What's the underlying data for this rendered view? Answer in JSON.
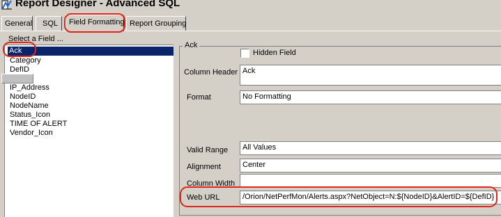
{
  "window": {
    "title": "Report Designer - Advanced SQL"
  },
  "tabs": [
    {
      "label": "General"
    },
    {
      "label": "SQL"
    },
    {
      "label": "Field Formatting"
    },
    {
      "label": "Report Grouping"
    }
  ],
  "field_list": {
    "caption": "Select a Field ...",
    "items": [
      "Ack",
      "Category",
      "DefID",
      "IP_Address",
      "NodeID",
      "NodeName",
      "Status_Icon",
      "TIME OF ALERT",
      "Vendor_Icon"
    ],
    "selected": "Ack"
  },
  "details": {
    "group_title": "Ack",
    "hidden_field": {
      "label": "Hidden Field",
      "checked": false
    },
    "column_header": {
      "label": "Column Header",
      "value": "Ack"
    },
    "format": {
      "label": "Format",
      "value": "No Formatting"
    },
    "valid_range": {
      "label": "Valid Range",
      "value": "All Values"
    },
    "alignment": {
      "label": "Alignment",
      "value": "Center"
    },
    "column_width": {
      "label": "Column Width",
      "value": ""
    },
    "web_url": {
      "label": "Web URL",
      "value": "/Orion/NetPerfMon/Alerts.aspx?NetObject=N:${NodeID}&AlertID=${DefID}"
    }
  },
  "colors": {
    "window_bg": "#d4d0c8",
    "selection": "#0a246a",
    "highlight_ring": "#e0241b"
  }
}
